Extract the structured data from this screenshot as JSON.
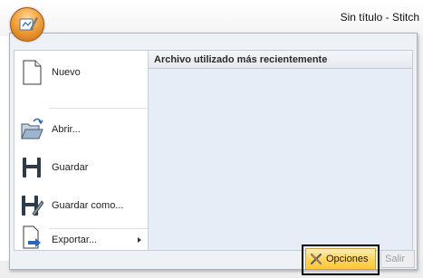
{
  "window": {
    "title": "Sin título - Stitch"
  },
  "menu": {
    "items": [
      {
        "label": "Nuevo",
        "icon": "new-document-icon"
      },
      {
        "label": "Abrir...",
        "icon": "open-folder-icon"
      },
      {
        "label": "Guardar",
        "icon": "save-icon"
      },
      {
        "label": "Guardar como...",
        "icon": "save-as-icon"
      },
      {
        "label": "Exportar...",
        "icon": "export-icon"
      }
    ],
    "recent_header": "Archivo utilizado más recientemente"
  },
  "buttons": {
    "options": "Opciones",
    "exit": "Salir"
  },
  "colors": {
    "highlight": "#ffd35b",
    "panel": "#e6edf6"
  }
}
